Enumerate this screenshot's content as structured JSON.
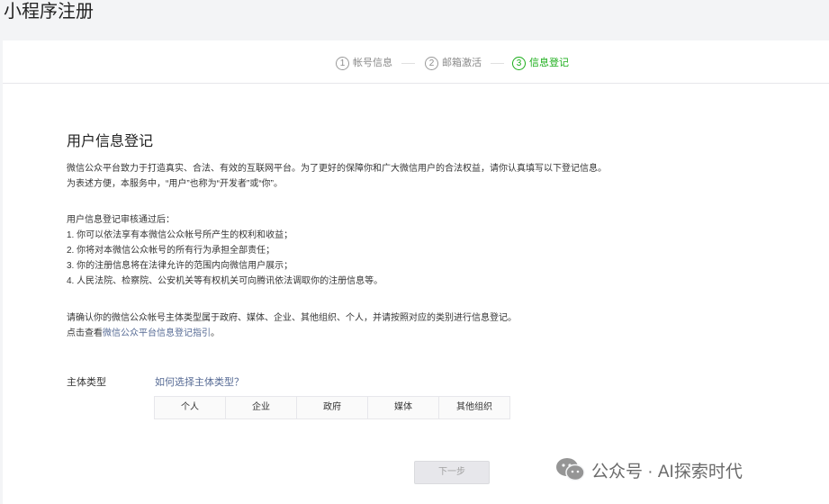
{
  "page": {
    "title": "小程序注册"
  },
  "steps": [
    {
      "num": "1",
      "label": "帐号信息"
    },
    {
      "num": "2",
      "label": "邮箱激活"
    },
    {
      "num": "3",
      "label": "信息登记"
    }
  ],
  "section": {
    "title": "用户信息登记",
    "intro": [
      "微信公众平台致力于打造真实、合法、有效的互联网平台。为了更好的保障你和广大微信用户的合法权益，请你认真填写以下登记信息。",
      "为表述方便，本服务中，“用户”也称为“开发者”或“你”。"
    ],
    "after_pass": {
      "heading": "用户信息登记审核通过后：",
      "items": [
        "1. 你可以依法享有本微信公众帐号所产生的权利和收益；",
        "2. 你将对本微信公众帐号的所有行为承担全部责任；",
        "3. 你的注册信息将在法律允许的范围内向微信用户展示；",
        "4. 人民法院、检察院、公安机关等有权机关可向腾讯依法调取你的注册信息等。"
      ]
    },
    "confirm_text": "请确认你的微信公众帐号主体类型属于政府、媒体、企业、其他组织、个人，并请按照对应的类别进行信息登记。",
    "guide_prefix": "点击查看",
    "guide_link": "微信公众平台信息登记指引",
    "guide_suffix": "。"
  },
  "subject": {
    "label": "主体类型",
    "help_link": "如何选择主体类型？",
    "options": [
      "个人",
      "企业",
      "政府",
      "媒体",
      "其他组织"
    ]
  },
  "next_button": "下一步",
  "watermark": "公众号 · AI探索时代",
  "colors": {
    "accent": "#1aad19",
    "link": "#576b95"
  }
}
